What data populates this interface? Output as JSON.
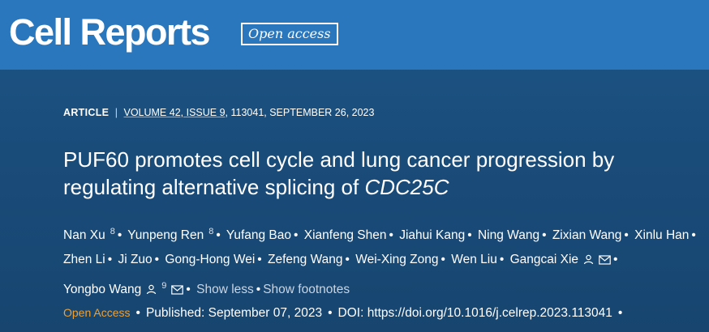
{
  "brand": "Cell Reports",
  "open_access_badge": "Open access",
  "meta": {
    "type": "ARTICLE",
    "separator": "|",
    "volume_issue": "VOLUME 42, ISSUE 9",
    "rest": ", 113041, SEPTEMBER 26, 2023"
  },
  "title": {
    "main": "PUF60 promotes cell cycle and lung cancer progression by regulating alternative splicing of ",
    "italic": "CDC25C"
  },
  "authors": [
    {
      "name": "Nan Xu",
      "aff": "8"
    },
    {
      "name": "Yunpeng Ren",
      "aff": "8"
    },
    {
      "name": "Yufang Bao"
    },
    {
      "name": "Xianfeng Shen"
    },
    {
      "name": "Jiahui Kang"
    },
    {
      "name": "Ning Wang"
    },
    {
      "name": "Zixian Wang"
    },
    {
      "name": "Xinlu Han"
    },
    {
      "name": "Zhen Li"
    },
    {
      "name": "Ji Zuo"
    },
    {
      "name": "Gong-Hong Wei"
    },
    {
      "name": "Zefeng Wang"
    },
    {
      "name": "Wei-Xing Zong"
    },
    {
      "name": "Wen Liu"
    },
    {
      "name": "Gangcai Xie",
      "icons": [
        "person-icon",
        "mail-icon"
      ]
    },
    {
      "name": "Yongbo Wang",
      "aff": "9",
      "icons": [
        "person-icon",
        "mail-icon"
      ]
    }
  ],
  "show_less": "Show less",
  "show_footnotes": "Show footnotes",
  "footer": {
    "open_access": "Open Access",
    "published": "Published: September 07, 2023",
    "doi_label": "DOI: ",
    "doi": "https://doi.org/10.1016/j.celrep.2023.113041"
  },
  "colors": {
    "header": "#2a77bd",
    "background": "#1a4e7c",
    "open_access": "#f0a030"
  }
}
